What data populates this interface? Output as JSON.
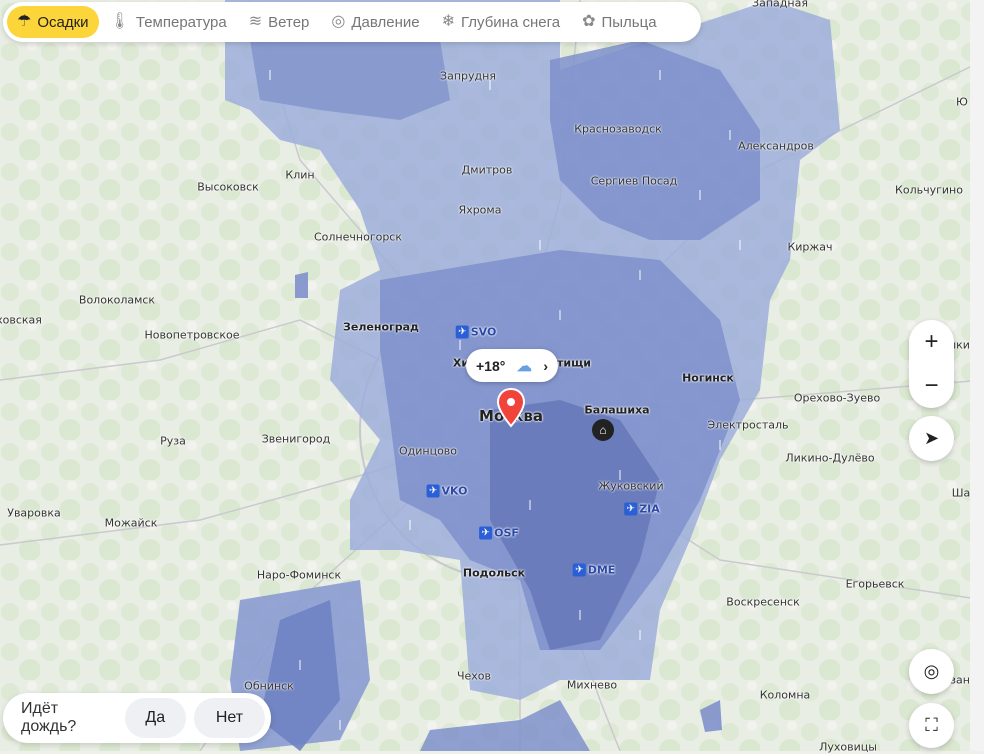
{
  "layer_tabs": [
    {
      "label": "Осадки",
      "icon": "rain-cloud-icon",
      "active": true
    },
    {
      "label": "Температура",
      "icon": "thermometer-icon",
      "active": false
    },
    {
      "label": "Ветер",
      "icon": "wind-icon",
      "active": false
    },
    {
      "label": "Давление",
      "icon": "gauge-icon",
      "active": false
    },
    {
      "label": "Глубина снега",
      "icon": "snowflake-icon",
      "active": false
    },
    {
      "label": "Пыльца",
      "icon": "pollen-icon",
      "active": false
    }
  ],
  "weather_chip": {
    "temperature": "+18°",
    "icon": "rain-cloud-icon"
  },
  "places": {
    "zapadnaya": "Западная",
    "zaprudnya": "Запрудня",
    "krasnozavodsk": "Краснозаводск",
    "aleksandrov": "Александров",
    "vysokovsk": "Высоковск",
    "klin": "Клин",
    "dmitrov": "Дмитров",
    "sergiev_posad": "Сергиев Посад",
    "kolchugino": "Кольчугино",
    "yakhroma": "Яхрома",
    "solnechnogorsk": "Солнечногорск",
    "kirzhach": "Киржач",
    "volokolamsk": "Волоколамск",
    "ruza_left": "ховская",
    "novopetrovskoe": "Новопетровское",
    "zelenograd": "Зеленоград",
    "khimki": "Хи",
    "mytishchi": "тищи",
    "noginsk": "Ногинск",
    "orekhovo": "Орехово-Зуево",
    "moskva": "Москва",
    "balashikha": "Балашиха",
    "elektrostal": "Электросталь",
    "ruza": "Руза",
    "zvenigorod": "Звенигород",
    "odintsovo": "Одинцово",
    "likino": "Ликино-Дулёво",
    "zhukovsky": "Жуковский",
    "uvarovka": "Уваровка",
    "mozhaysk": "Можайск",
    "naro_fominsk": "Наро-Фоминск",
    "podolsk": "Подольск",
    "egoryevsk": "Егорьевск",
    "voskresensk": "Воскресенск",
    "obninsk": "Обнинск",
    "chekhov": "Чехов",
    "mikhnevo": "Михнево",
    "kolomna": "Коломна",
    "dukhovitsy": "Луховицы",
    "sha": "Ша",
    "yu": "Ю",
    "shi": "шки",
    "zan": "зан"
  },
  "airports": [
    {
      "code": "SVO"
    },
    {
      "code": "VKO"
    },
    {
      "code": "ZIA"
    },
    {
      "code": "OSF"
    },
    {
      "code": "DME"
    }
  ],
  "controls": {
    "zoom_in": "+",
    "zoom_out": "−"
  },
  "rain_question": {
    "text": "Идёт дождь?",
    "yes": "Да",
    "no": "Нет"
  },
  "colors": {
    "precip_light": "#9eaedb",
    "precip_mid": "#7f90cb",
    "precip_dark": "#6476b8",
    "accent": "#fcd53a",
    "pin": "#f0433a"
  }
}
